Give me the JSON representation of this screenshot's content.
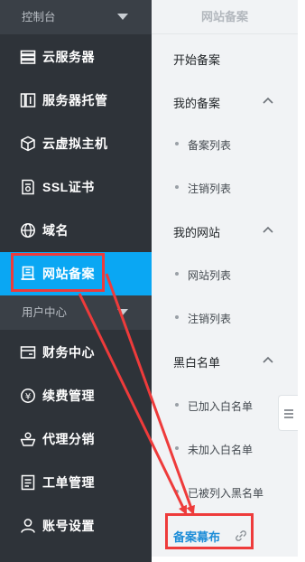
{
  "sidebar": {
    "section1": {
      "title": "控制台"
    },
    "items1": [
      {
        "label": "云服务器",
        "icon": "server-list-icon"
      },
      {
        "label": "服务器托管",
        "icon": "server-hosting-icon"
      },
      {
        "label": "云虚拟主机",
        "icon": "cube-icon"
      },
      {
        "label": "SSL证书",
        "icon": "certificate-icon"
      },
      {
        "label": "域名",
        "icon": "globe-icon"
      },
      {
        "label": "网站备案",
        "icon": "record-icon",
        "active": true
      }
    ],
    "section2": {
      "title": "用户中心"
    },
    "items2": [
      {
        "label": "财务中心",
        "icon": "wallet-icon"
      },
      {
        "label": "续费管理",
        "icon": "renewal-icon"
      },
      {
        "label": "代理分销",
        "icon": "agent-icon"
      },
      {
        "label": "工单管理",
        "icon": "ticket-icon"
      },
      {
        "label": "账号设置",
        "icon": "user-icon"
      }
    ]
  },
  "panel": {
    "title": "网站备案",
    "start_label": "开始备案",
    "groups": [
      {
        "label": "我的备案",
        "expanded": true,
        "children": [
          "备案列表",
          "注销列表"
        ]
      },
      {
        "label": "我的网站",
        "expanded": true,
        "children": [
          "网站列表",
          "注销列表"
        ]
      },
      {
        "label": "黑白名单",
        "expanded": true,
        "children": [
          "已加入白名单",
          "未加入白名单",
          "已被列入黑名单"
        ]
      }
    ],
    "link_label": "备案幕布",
    "link_icon": "link-icon"
  },
  "colors": {
    "sidebar_bg": "#2e3339",
    "section_header_bg": "#3a4047",
    "active_bg": "#0aa7f3",
    "panel_bg": "#f1f3f5",
    "link_color": "#1f8ed8",
    "annotation_red": "#ee3b3b"
  }
}
